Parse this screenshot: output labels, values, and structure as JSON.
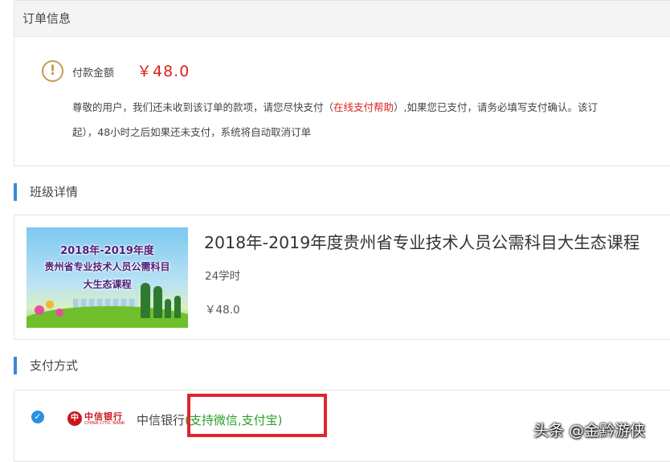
{
  "order_info": {
    "header": "订单信息",
    "amount_label": "付款金额",
    "amount_value": "￥48.0",
    "notice_line1_prefix": "尊敬的用户，我们还未收到该订单的款项，请您尽快支付（",
    "notice_link": "在线支付帮助",
    "notice_line1_suffix": "）,如果您已支付，请务必填写支付确认。该订",
    "notice_line2": "起），48小时之后如果还未支付，系统将自动取消订单",
    "warning_icon": "exclamation-circle-icon"
  },
  "class_detail": {
    "section_title": "班级详情",
    "banner": {
      "line1": "2018年-2019年度",
      "line2": "贵州省专业技术人员公需科目",
      "line3": "大生态课程"
    },
    "course_title": "2018年-2019年度贵州省专业技术人员公需科目大生态课程",
    "hours": "24学时",
    "price": "￥48.0"
  },
  "payment": {
    "section_title": "支付方式",
    "bank_logo_cn": "中信银行",
    "bank_logo_en": "CHINA CITIC BANK",
    "bank_name": "中信银行",
    "bank_support": "(支持微信,支付宝)",
    "selected": true,
    "check_icon": "check-circle-icon"
  },
  "watermark": "头条 @金黔游侠",
  "colors": {
    "accent_blue": "#3c86d6",
    "price_red": "#d9221c",
    "support_green": "#2aa02a",
    "highlight_box": "#e0262c"
  }
}
